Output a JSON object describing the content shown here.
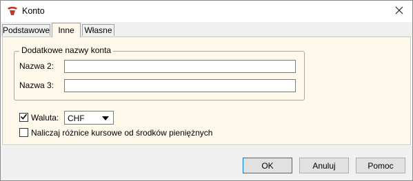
{
  "window": {
    "title": "Konto",
    "icon": "app-logo-icon",
    "close_icon": "close-icon"
  },
  "tabs": [
    {
      "label": "Podstawowe",
      "active": false
    },
    {
      "label": "Inne",
      "active": true
    },
    {
      "label": "Własne",
      "active": false
    }
  ],
  "group": {
    "legend": "Dodatkowe nazwy konta",
    "name2_label": "Nazwa 2:",
    "name2_value": "",
    "name3_label": "Nazwa 3:",
    "name3_value": ""
  },
  "currency": {
    "checked": true,
    "label": "Waluta:",
    "value": "CHF"
  },
  "fx_diff": {
    "checked": false,
    "label": "Naliczaj różnice kursowe od środków pieniężnych"
  },
  "buttons": {
    "ok": "OK",
    "cancel": "Anuluj",
    "help": "Pomoc"
  },
  "colors": {
    "content_bg": "#fdf8ea",
    "chrome_bg": "#f0f0f0",
    "focus_border": "#0078d7"
  }
}
